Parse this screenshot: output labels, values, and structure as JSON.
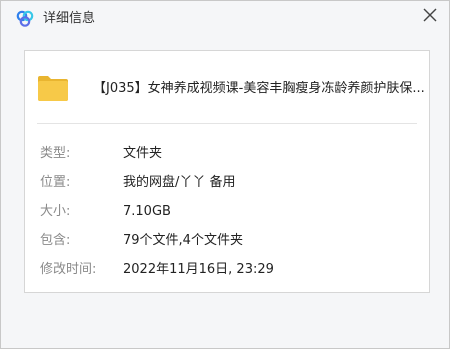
{
  "window": {
    "title": "详细信息"
  },
  "file": {
    "name": "【J035】女神养成视频课-美容丰胸瘦身冻龄养颜护肤保..."
  },
  "details": [
    {
      "label": "类型:",
      "value": "文件夹"
    },
    {
      "label": "位置:",
      "value": "我的网盘/丫丫 备用"
    },
    {
      "label": "大小:",
      "value": "7.10GB"
    },
    {
      "label": "包含:",
      "value": "79个文件,4个文件夹"
    },
    {
      "label": "修改时间:",
      "value": "2022年11月16日, 23:29"
    }
  ],
  "icons": {
    "app_logo": "cloud-logo-icon",
    "close": "close-icon",
    "folder": "folder-icon"
  },
  "colors": {
    "folder_yellow": "#f7c948",
    "logo_blue": "#2f80ed",
    "logo_cyan": "#37c7e8"
  }
}
